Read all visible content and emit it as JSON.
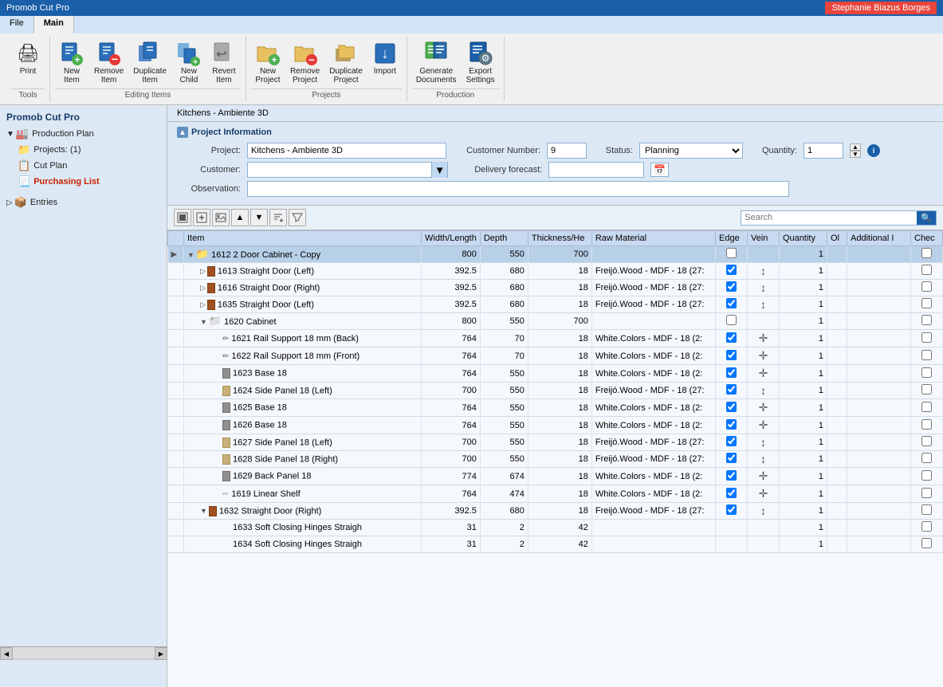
{
  "titleBar": {
    "appName": "Promob Cut Pro",
    "user": "Stephanie Biazus Borges"
  },
  "ribbon": {
    "tabs": [
      "File",
      "Main"
    ],
    "activeTab": "Main",
    "groups": [
      {
        "label": "Tools",
        "buttons": [
          {
            "id": "print",
            "label": "Print",
            "icon": "🖨"
          }
        ]
      },
      {
        "label": "Editing Items",
        "buttons": [
          {
            "id": "new-item",
            "label": "New Item",
            "icon": "📄"
          },
          {
            "id": "remove-item",
            "label": "Remove Item",
            "icon": "🗑"
          },
          {
            "id": "duplicate-item",
            "label": "Duplicate Item",
            "icon": "📋"
          },
          {
            "id": "new-child",
            "label": "New Child",
            "icon": "📑"
          },
          {
            "id": "revert-item",
            "label": "Revert Item",
            "icon": "↩"
          }
        ]
      },
      {
        "label": "Projects",
        "buttons": [
          {
            "id": "new-project",
            "label": "New Project",
            "icon": "📁"
          },
          {
            "id": "remove-project",
            "label": "Remove Project",
            "icon": "🗑"
          },
          {
            "id": "duplicate-project",
            "label": "Duplicate Project",
            "icon": "📋"
          },
          {
            "id": "import",
            "label": "Import",
            "icon": "📥"
          }
        ]
      },
      {
        "label": "Production",
        "buttons": [
          {
            "id": "generate-documents",
            "label": "Generate Documents",
            "icon": "📊"
          },
          {
            "id": "export-settings",
            "label": "Export Settings",
            "icon": "⚙"
          }
        ]
      }
    ]
  },
  "sidebar": {
    "title": "Promob Cut Pro",
    "items": [
      {
        "id": "production-plan",
        "label": "Production Plan",
        "level": 0,
        "type": "folder",
        "expanded": true
      },
      {
        "id": "projects",
        "label": "Projects: (1)",
        "level": 1,
        "type": "folder"
      },
      {
        "id": "cut-plan",
        "label": "Cut Plan",
        "level": 1,
        "type": "list"
      },
      {
        "id": "purchasing-list",
        "label": "Purchasing List",
        "level": 1,
        "type": "list",
        "active": true
      },
      {
        "id": "entries",
        "label": "Entries",
        "level": 0,
        "type": "folder"
      }
    ]
  },
  "contentTab": "Kitchens - Ambiente 3D",
  "projectInfo": {
    "sectionLabel": "Project Information",
    "projectLabel": "Project:",
    "projectValue": "Kitchens - Ambiente 3D",
    "customerNumberLabel": "Customer Number:",
    "customerNumberValue": "9",
    "statusLabel": "Status:",
    "statusValue": "Planning",
    "quantityLabel": "Quantity:",
    "quantityValue": "1",
    "customerLabel": "Customer:",
    "customerValue": "",
    "deliveryForecastLabel": "Delivery forecast:",
    "deliveryForecastValue": "",
    "observationLabel": "Observation:",
    "observationValue": ""
  },
  "toolbar": {
    "searchPlaceholder": "Search"
  },
  "tableHeaders": [
    "",
    "Item",
    "Width/Length",
    "Depth",
    "Thickness/He",
    "Raw Material",
    "Edge",
    "Vein",
    "Quantity",
    "Ol",
    "Additional I",
    "Chec"
  ],
  "tableRows": [
    {
      "id": "1612",
      "level": 0,
      "expanded": true,
      "arrow": "▶",
      "label": "1612  2 Door Cabinet - Copy",
      "width": "800",
      "depth": "550",
      "thick": "700",
      "material": "",
      "edge": true,
      "vein": "",
      "qty": "1",
      "type": "folder",
      "selected": true
    },
    {
      "id": "1613",
      "level": 1,
      "expanded": false,
      "arrow": "▷",
      "label": "1613  Straight Door (Left)",
      "width": "392.5",
      "depth": "680",
      "thick": "18",
      "material": "Freijó.Wood - MDF - 18 (27:",
      "edge": true,
      "vein": "↕",
      "qty": "1",
      "type": "part-brown"
    },
    {
      "id": "1616",
      "level": 1,
      "expanded": false,
      "arrow": "▷",
      "label": "1616  Straight Door (Right)",
      "width": "392.5",
      "depth": "680",
      "thick": "18",
      "material": "Freijó.Wood - MDF - 18 (27:",
      "edge": true,
      "vein": "↕",
      "qty": "1",
      "type": "part-brown"
    },
    {
      "id": "1635",
      "level": 1,
      "expanded": false,
      "arrow": "▷",
      "label": "1635  Straight Door (Left)",
      "width": "392.5",
      "depth": "680",
      "thick": "18",
      "material": "Freijó.Wood - MDF - 18 (27:",
      "edge": true,
      "vein": "↕",
      "qty": "1",
      "type": "part-brown"
    },
    {
      "id": "1620",
      "level": 1,
      "expanded": true,
      "arrow": "▼",
      "label": "1620  Cabinet",
      "width": "800",
      "depth": "550",
      "thick": "700",
      "material": "",
      "edge": true,
      "vein": "",
      "qty": "1",
      "type": "folder-gray"
    },
    {
      "id": "1621",
      "level": 2,
      "label": "1621  Rail Support 18 mm (Back)",
      "width": "764",
      "depth": "70",
      "thick": "18",
      "material": "White.Colors - MDF - 18 (2:",
      "edge": true,
      "vein": "✛",
      "qty": "1",
      "type": "pencil"
    },
    {
      "id": "1622",
      "level": 2,
      "label": "1622  Rail Support 18 mm (Front)",
      "width": "764",
      "depth": "70",
      "thick": "18",
      "material": "White.Colors - MDF - 18 (2:",
      "edge": true,
      "vein": "✛",
      "qty": "1",
      "type": "pencil"
    },
    {
      "id": "1623",
      "level": 2,
      "label": "1623  Base 18",
      "width": "764",
      "depth": "550",
      "thick": "18",
      "material": "White.Colors - MDF - 18 (2:",
      "edge": true,
      "vein": "✛",
      "qty": "1",
      "type": "part-gray"
    },
    {
      "id": "1624",
      "level": 2,
      "label": "1624  Side Panel 18 (Left)",
      "width": "700",
      "depth": "550",
      "thick": "18",
      "material": "Freijó.Wood - MDF - 18 (27:",
      "edge": true,
      "vein": "↕",
      "qty": "1",
      "type": "part-light"
    },
    {
      "id": "1625",
      "level": 2,
      "label": "1625  Base 18",
      "width": "764",
      "depth": "550",
      "thick": "18",
      "material": "White.Colors - MDF - 18 (2:",
      "edge": true,
      "vein": "✛",
      "qty": "1",
      "type": "part-gray"
    },
    {
      "id": "1626",
      "level": 2,
      "label": "1626  Base 18",
      "width": "764",
      "depth": "550",
      "thick": "18",
      "material": "White.Colors - MDF - 18 (2:",
      "edge": true,
      "vein": "✛",
      "qty": "1",
      "type": "part-gray"
    },
    {
      "id": "1627",
      "level": 2,
      "label": "1627  Side Panel 18 (Left)",
      "width": "700",
      "depth": "550",
      "thick": "18",
      "material": "Freijó.Wood - MDF - 18 (27:",
      "edge": true,
      "vein": "↕",
      "qty": "1",
      "type": "part-light"
    },
    {
      "id": "1628",
      "level": 2,
      "label": "1628  Side Panel 18 (Right)",
      "width": "700",
      "depth": "550",
      "thick": "18",
      "material": "Freijó.Wood - MDF - 18 (27:",
      "edge": true,
      "vein": "↕",
      "qty": "1",
      "type": "part-light"
    },
    {
      "id": "1629",
      "level": 2,
      "label": "1629  Back Panel 18",
      "width": "774",
      "depth": "674",
      "thick": "18",
      "material": "White.Colors - MDF - 18 (2:",
      "edge": true,
      "vein": "✛",
      "qty": "1",
      "type": "part-gray"
    },
    {
      "id": "1619",
      "level": 2,
      "label": "1619  Linear Shelf",
      "width": "764",
      "depth": "474",
      "thick": "18",
      "material": "White.Colors - MDF - 18 (2:",
      "edge": true,
      "vein": "✛",
      "qty": "1",
      "type": "pencil-gray"
    },
    {
      "id": "1632",
      "level": 1,
      "expanded": true,
      "arrow": "▼",
      "label": "1632  Straight Door (Right)",
      "width": "392.5",
      "depth": "680",
      "thick": "18",
      "material": "Freijó.Wood - MDF - 18 (27:",
      "edge": true,
      "vein": "↕",
      "qty": "1",
      "type": "part-brown"
    },
    {
      "id": "1633",
      "level": 2,
      "label": "1633  Soft Closing Hinges Straigh",
      "width": "31",
      "depth": "2",
      "thick": "42",
      "material": "",
      "edge": false,
      "vein": "",
      "qty": "1",
      "type": "none"
    },
    {
      "id": "1634",
      "level": 2,
      "label": "1634  Soft Closing Hinges Straigh",
      "width": "31",
      "depth": "2",
      "thick": "42",
      "material": "",
      "edge": false,
      "vein": "",
      "qty": "1",
      "type": "none"
    }
  ]
}
